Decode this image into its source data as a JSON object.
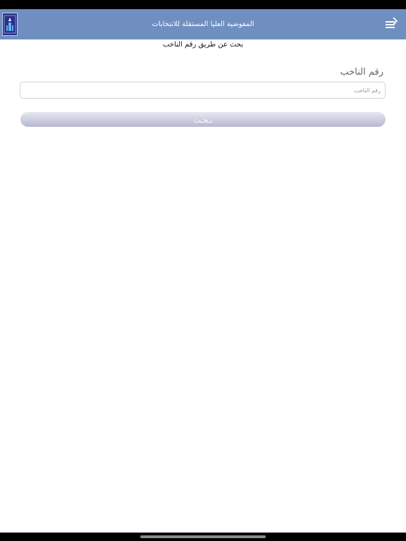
{
  "header": {
    "title": "المفوضية العليا المستقلة للانتخابات",
    "logo_icon": "ihec-logo-icon",
    "menu_icon": "menu-back-icon",
    "background_color": "#6f8fc0"
  },
  "page": {
    "subtitle": "بحث عن طريق رقم الناخب"
  },
  "form": {
    "voter_number_label": "رقم الناخب",
    "voter_number_placeholder": "رقم الناخب",
    "voter_number_value": "",
    "search_button_label": "بـحـث"
  }
}
